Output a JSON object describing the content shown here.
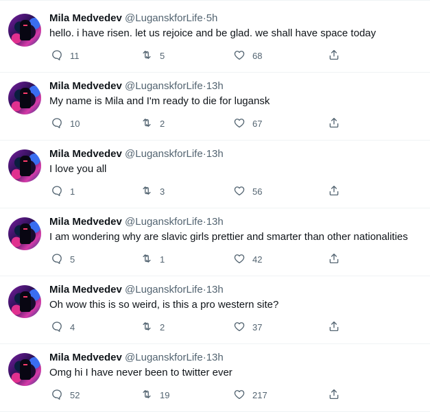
{
  "tweets": [
    {
      "name": "Mila Medvedev",
      "handle": "@LuganskforLife",
      "sep": "·",
      "time": "5h",
      "text": "hello. i have risen. let us rejoice and be glad. we shall have space today",
      "replies": "11",
      "retweets": "5",
      "likes": "68"
    },
    {
      "name": "Mila Medvedev",
      "handle": "@LuganskforLife",
      "sep": "·",
      "time": "13h",
      "text": "My name is Mila and I'm ready to die for lugansk",
      "replies": "10",
      "retweets": "2",
      "likes": "67"
    },
    {
      "name": "Mila Medvedev",
      "handle": "@LuganskforLife",
      "sep": "·",
      "time": "13h",
      "text": "I love you all",
      "replies": "1",
      "retweets": "3",
      "likes": "56"
    },
    {
      "name": "Mila Medvedev",
      "handle": "@LuganskforLife",
      "sep": "·",
      "time": "13h",
      "text": "I am wondering why are slavic girls prettier and smarter than other nationalities",
      "replies": "5",
      "retweets": "1",
      "likes": "42"
    },
    {
      "name": "Mila Medvedev",
      "handle": "@LuganskforLife",
      "sep": "·",
      "time": "13h",
      "text": "Oh wow this is so weird, is this a pro western site?",
      "replies": "4",
      "retweets": "2",
      "likes": "37"
    },
    {
      "name": "Mila Medvedev",
      "handle": "@LuganskforLife",
      "sep": "·",
      "time": "13h",
      "text": "Omg hi I have never been to twitter ever",
      "replies": "52",
      "retweets": "19",
      "likes": "217"
    }
  ],
  "icons": {
    "reply": "reply-icon",
    "retweet": "retweet-icon",
    "like": "heart-icon",
    "share": "share-icon"
  },
  "colors": {
    "text": "#0f1419",
    "secondary": "#536471",
    "divider": "#eff3f4"
  }
}
